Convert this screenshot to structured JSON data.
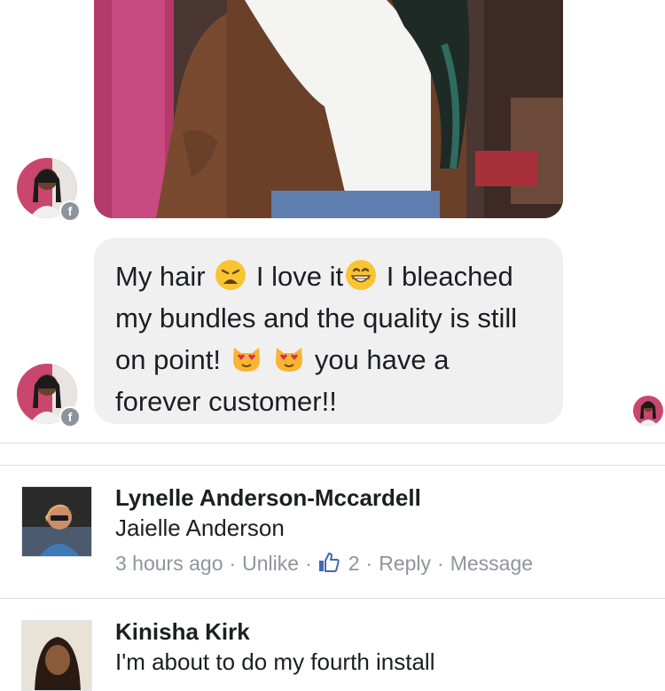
{
  "message": {
    "line1_a": "My hair",
    "line1_b": "I love it",
    "line1_c": "I bleached",
    "line2": "my bundles and the quality is still",
    "line3_a": "on point!",
    "line3_b": "you have a",
    "line4": "forever customer!!",
    "emojis": [
      "weary-face",
      "grinning-face",
      "heart-eyes-cat",
      "heart-eyes-cat"
    ]
  },
  "comments": [
    {
      "author": "Lynelle Anderson-Mccardell",
      "text": "Jaielle Anderson",
      "time": "3 hours ago",
      "unlike": "Unlike",
      "likes": "2",
      "reply": "Reply",
      "message": "Message"
    },
    {
      "author": "Kinisha Kirk",
      "text": "I'm about to do my fourth install"
    }
  ],
  "colors": {
    "bubble": "#f1f0f0",
    "meta": "#90949c",
    "like_blue": "#4267b2",
    "divider": "#dddfe2"
  }
}
